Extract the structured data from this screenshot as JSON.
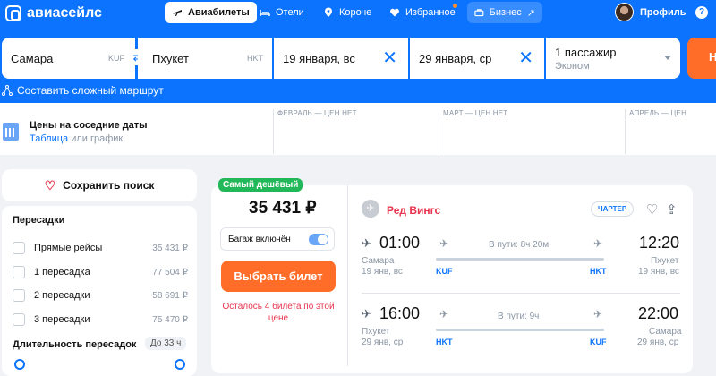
{
  "brand": {
    "name": "авиасейлс"
  },
  "nav": {
    "flights": "Авиабилеты",
    "hotels": "Отели",
    "shorter": "Короче",
    "favorites": "Избранное",
    "business": "Бизнес",
    "profile": "Профиль",
    "help": "?"
  },
  "search": {
    "from": "Самара",
    "from_code": "KUF",
    "to": "Пхукет",
    "to_code": "HKT",
    "depart": "19 января, вс",
    "return": "29 января, ср",
    "passengers": "1 пассажир",
    "class": "Эконом",
    "complex_route": "Составить сложный маршрут"
  },
  "dates": {
    "title": "Цены на соседние даты",
    "table": "Таблица",
    "or": "или",
    "graph": "график",
    "months": [
      "ФЕВРАЛЬ — ЦЕН НЕТ",
      "МАРТ — ЦЕН НЕТ",
      "АПРЕЛЬ — ЦЕН"
    ]
  },
  "sidebar": {
    "save_search": "Сохранить поиск",
    "transfers_title": "Пересадки",
    "transfers": [
      {
        "label": "Прямые рейсы",
        "price": "35 431 ₽"
      },
      {
        "label": "1 пересадка",
        "price": "77 504 ₽"
      },
      {
        "label": "2 пересадки",
        "price": "58 691 ₽"
      },
      {
        "label": "3 пересадки",
        "price": "75 470 ₽"
      }
    ],
    "duration_title": "Длительность пересадок",
    "duration_value": "До 33 ч"
  },
  "ticket": {
    "badge": "Самый дешёвый",
    "price": "35 431 ₽",
    "baggage": "Багаж включён",
    "baggage_on": true,
    "buy": "Выбрать билет",
    "seats_left": "Осталось 4 билета по этой цене",
    "airline": "Ред Вингс",
    "charter": "ЧАРТЕР",
    "segments": [
      {
        "dep_time": "01:00",
        "dep_city": "Самара",
        "dep_date": "19 янв, вс",
        "duration": "В пути: 8ч 20м",
        "from_code": "KUF",
        "to_code": "HKT",
        "arr_time": "12:20",
        "arr_city": "Пхукет",
        "arr_date": "19 янв, вс"
      },
      {
        "dep_time": "16:00",
        "dep_city": "Пхукет",
        "dep_date": "29 янв, ср",
        "duration": "В пути: 9ч",
        "from_code": "HKT",
        "to_code": "KUF",
        "arr_time": "22:00",
        "arr_city": "Самара",
        "arr_date": "29 янв, ср"
      }
    ]
  },
  "colors": {
    "brand_blue": "#0b73fe",
    "orange": "#ff6d29",
    "green": "#22b859",
    "red": "#e8344e"
  }
}
